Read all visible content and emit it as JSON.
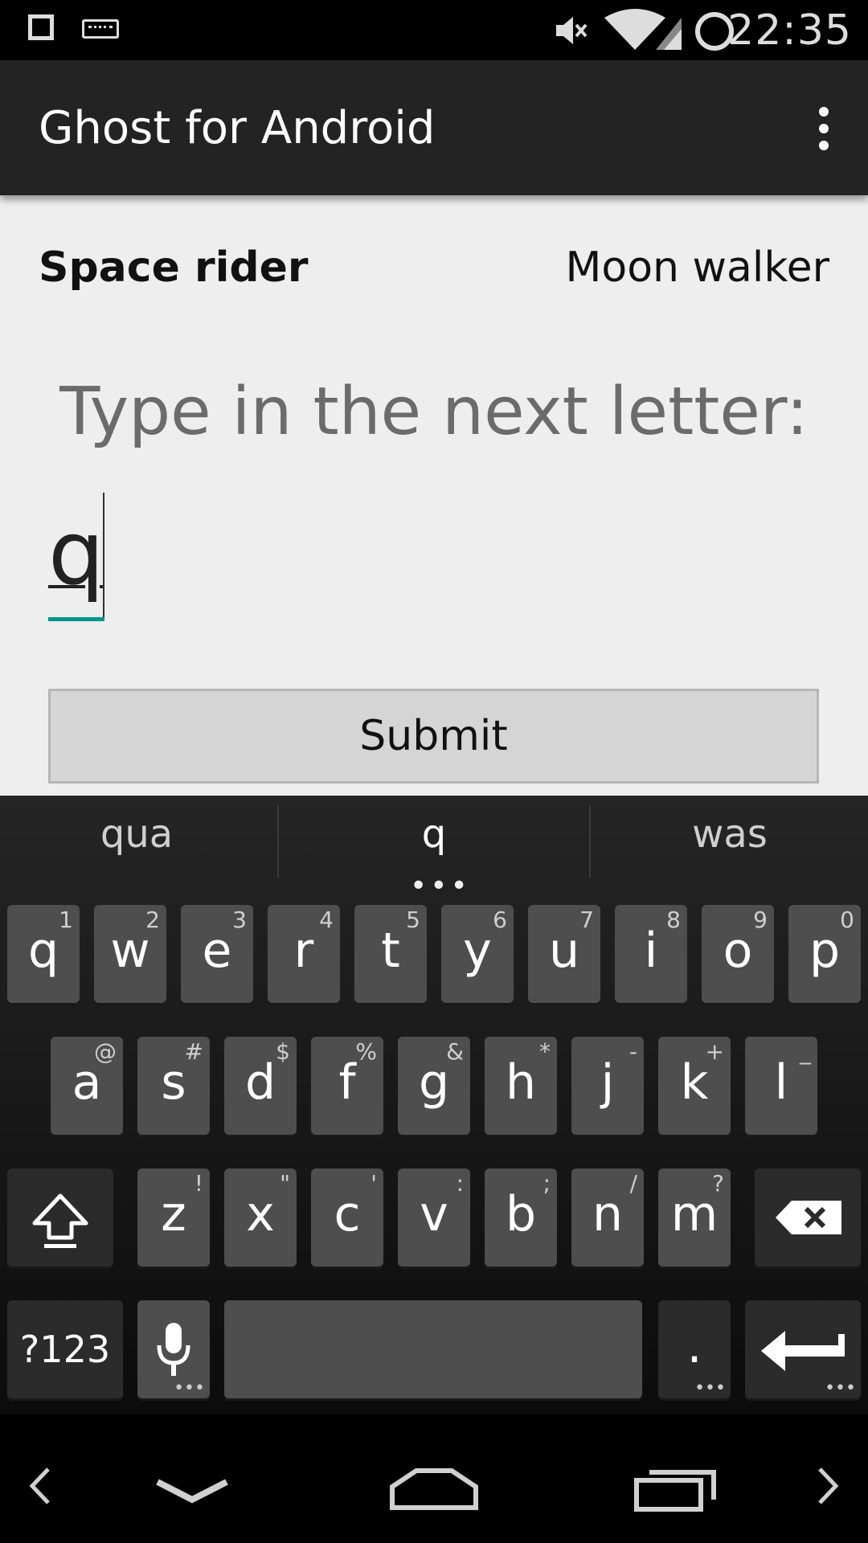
{
  "status": {
    "time": "22:35"
  },
  "appbar": {
    "title": "Ghost for Android"
  },
  "players": {
    "left": "Space rider",
    "right": "Moon walker"
  },
  "prompt": "Type in the next letter:",
  "input": {
    "value": "q"
  },
  "submit_label": "Submit",
  "suggestions": [
    "qua",
    "q",
    "was"
  ],
  "keyboard": {
    "row1": [
      {
        "k": "q",
        "h": "1"
      },
      {
        "k": "w",
        "h": "2"
      },
      {
        "k": "e",
        "h": "3"
      },
      {
        "k": "r",
        "h": "4"
      },
      {
        "k": "t",
        "h": "5"
      },
      {
        "k": "y",
        "h": "6"
      },
      {
        "k": "u",
        "h": "7"
      },
      {
        "k": "i",
        "h": "8"
      },
      {
        "k": "o",
        "h": "9"
      },
      {
        "k": "p",
        "h": "0"
      }
    ],
    "row2": [
      {
        "k": "a",
        "h": "@"
      },
      {
        "k": "s",
        "h": "#"
      },
      {
        "k": "d",
        "h": "$"
      },
      {
        "k": "f",
        "h": "%"
      },
      {
        "k": "g",
        "h": "&"
      },
      {
        "k": "h",
        "h": "*"
      },
      {
        "k": "j",
        "h": "-"
      },
      {
        "k": "k",
        "h": "+"
      },
      {
        "k": "l",
        "h": "_"
      }
    ],
    "row3": [
      {
        "k": "z",
        "h": "!"
      },
      {
        "k": "x",
        "h": "\""
      },
      {
        "k": "c",
        "h": "'"
      },
      {
        "k": "v",
        "h": ":"
      },
      {
        "k": "b",
        "h": ";"
      },
      {
        "k": "n",
        "h": "/"
      },
      {
        "k": "m",
        "h": "?"
      }
    ],
    "symbols_label": "?123",
    "period_label": "."
  }
}
